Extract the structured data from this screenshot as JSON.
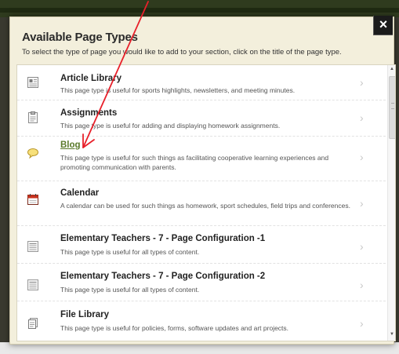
{
  "modal": {
    "title": "Available Page Types",
    "subtitle": "To select the type of page you would like to add to your section, click on the title of the page type.",
    "close_label": "×"
  },
  "page_types": [
    {
      "name": "Article Library",
      "description": "This page type is useful for sports highlights, newsletters, and meeting minutes.",
      "icon": "article-library-icon"
    },
    {
      "name": "Assignments",
      "description": "This page type is useful for adding and displaying homework assignments.",
      "icon": "assignments-icon"
    },
    {
      "name": "Blog",
      "description": "This page type is useful for such things as facilitating cooperative learning experiences and promoting communication with parents.",
      "icon": "blog-icon"
    },
    {
      "name": "Calendar",
      "description": "A calendar can be used for such things as homework, sport schedules, field trips and conferences.",
      "icon": "calendar-icon"
    },
    {
      "name": "Elementary Teachers - 7 - Page Configuration -1",
      "description": "This page type is useful for all types of content.",
      "icon": "page-configuration-icon"
    },
    {
      "name": "Elementary Teachers - 7 - Page Configuration -2",
      "description": "This page type is useful for all types of content.",
      "icon": "page-configuration-icon"
    },
    {
      "name": "File Library",
      "description": "This page type is useful for policies, forms, software updates and art projects.",
      "icon": "file-library-icon"
    }
  ],
  "chevron": "›",
  "colors": {
    "highlight_link": "#5a7a2a",
    "annotation_arrow": "#e8202a"
  }
}
